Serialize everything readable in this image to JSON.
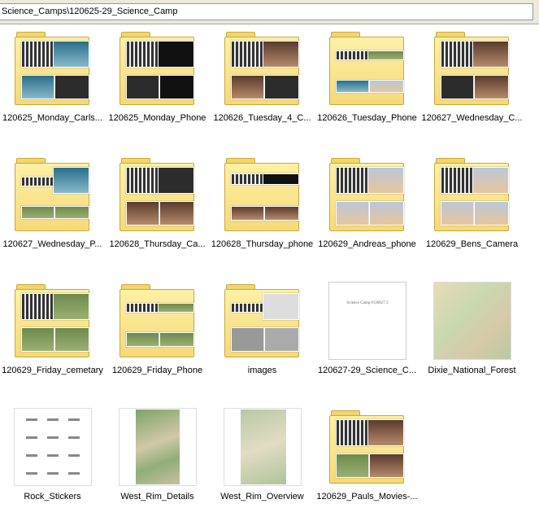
{
  "address": {
    "path": "Science_Camps\\120625-29_Science_Camp"
  },
  "items": [
    {
      "label": "120625_Monday_Carls...",
      "icon": "folder-thumbnail-icon"
    },
    {
      "label": "120625_Monday_Phone",
      "icon": "folder-thumbnail-icon"
    },
    {
      "label": "120626_Tuesday_4_C...",
      "icon": "folder-thumbnail-icon"
    },
    {
      "label": "120626_Tuesday_Phone",
      "icon": "folder-thumbnail-icon"
    },
    {
      "label": "120627_Wednesday_C...",
      "icon": "folder-thumbnail-icon"
    },
    {
      "label": "120627_Wednesday_P...",
      "icon": "folder-thumbnail-icon"
    },
    {
      "label": "120628_Thursday_Ca...",
      "icon": "folder-thumbnail-icon"
    },
    {
      "label": "120628_Thursday_phone",
      "icon": "folder-thumbnail-icon"
    },
    {
      "label": "120629_Andreas_phone",
      "icon": "folder-thumbnail-icon"
    },
    {
      "label": "120629_Bens_Camera",
      "icon": "folder-thumbnail-icon"
    },
    {
      "label": "120629_Friday_cemetary",
      "icon": "folder-thumbnail-icon"
    },
    {
      "label": "120629_Friday_Phone",
      "icon": "folder-thumbnail-icon"
    },
    {
      "label": "images",
      "icon": "folder-thumbnail-icon"
    },
    {
      "label": "120627-29_Science_C...",
      "icon": "document-thumbnail-icon",
      "doc_title": "Science Camp #120627.3"
    },
    {
      "label": "Dixie_National_Forest",
      "icon": "map-thumbnail-icon"
    },
    {
      "label": "Rock_Stickers",
      "icon": "stickers-thumbnail-icon"
    },
    {
      "label": "West_Rim_Details",
      "icon": "relief-map-thumbnail-icon"
    },
    {
      "label": "West_Rim_Overview",
      "icon": "relief-map-thumbnail-icon"
    },
    {
      "label": "120629_Pauls_Movies-...",
      "icon": "folder-thumbnail-icon"
    }
  ]
}
